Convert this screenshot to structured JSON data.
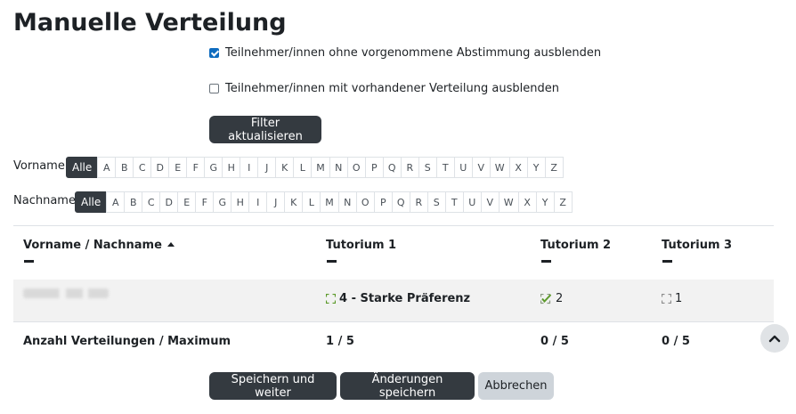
{
  "page": {
    "title": "Manuelle Verteilung"
  },
  "filters": {
    "hide_no_vote": {
      "label": "Teilnehmer/innen ohne vorgenommene Abstimmung ausblenden",
      "checked": true
    },
    "hide_allocated": {
      "label": "Teilnehmer/innen mit vorhandener Verteilung ausblenden",
      "checked": false
    },
    "update_button": "Filter aktualisieren"
  },
  "initials_bar": {
    "firstname_label": "Vorname",
    "lastname_label": "Nachname",
    "all_label": "Alle",
    "letters": [
      "A",
      "B",
      "C",
      "D",
      "E",
      "F",
      "G",
      "H",
      "I",
      "J",
      "K",
      "L",
      "M",
      "N",
      "O",
      "P",
      "Q",
      "R",
      "S",
      "T",
      "U",
      "V",
      "W",
      "X",
      "Y",
      "Z"
    ]
  },
  "table": {
    "header_name": "Vorname / Nachname",
    "columns": [
      "Tutorium 1",
      "Tutorium 2",
      "Tutorium 3"
    ],
    "rows": [
      {
        "cells": [
          "4 - Starke Präferenz",
          "2",
          "1"
        ]
      }
    ],
    "footer_label": "Anzahl Verteilungen / Maximum",
    "footer_values": [
      "1 / 5",
      "0 / 5",
      "0 / 5"
    ]
  },
  "actions": {
    "save_continue": "Speichern und weiter",
    "save_changes": "Änderungen speichern",
    "cancel": "Abbrechen"
  },
  "colors": {
    "primary": "#0f6cbf",
    "dark_button": "#343a40",
    "check_green": "#5c9a2a"
  }
}
